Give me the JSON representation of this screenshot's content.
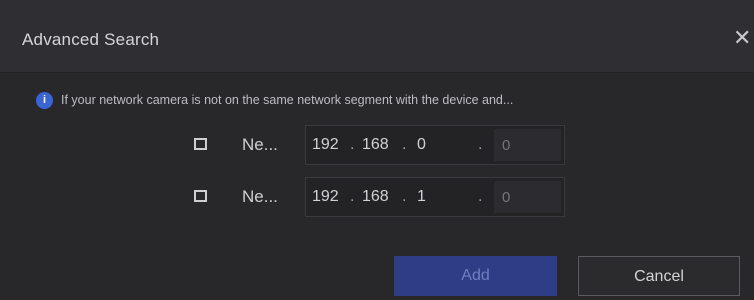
{
  "dialog": {
    "title": "Advanced Search",
    "close_glyph": "✕",
    "info_icon": "info-icon",
    "info_icon_glyph": "i",
    "info_text": "If your network camera is not on the same network segment with the device and..."
  },
  "segments": [
    {
      "label": "Ne...",
      "checked": false,
      "octets": [
        "192",
        "168",
        "0"
      ],
      "last_octet_placeholder": "0"
    },
    {
      "label": "Ne...",
      "checked": false,
      "octets": [
        "192",
        "168",
        "1"
      ],
      "last_octet_placeholder": "0"
    }
  ],
  "buttons": {
    "add_label": "Add",
    "cancel_label": "Cancel"
  },
  "colors": {
    "background": "#28282b",
    "accent": "#3a64d6",
    "add_button": "#2e3e86"
  }
}
